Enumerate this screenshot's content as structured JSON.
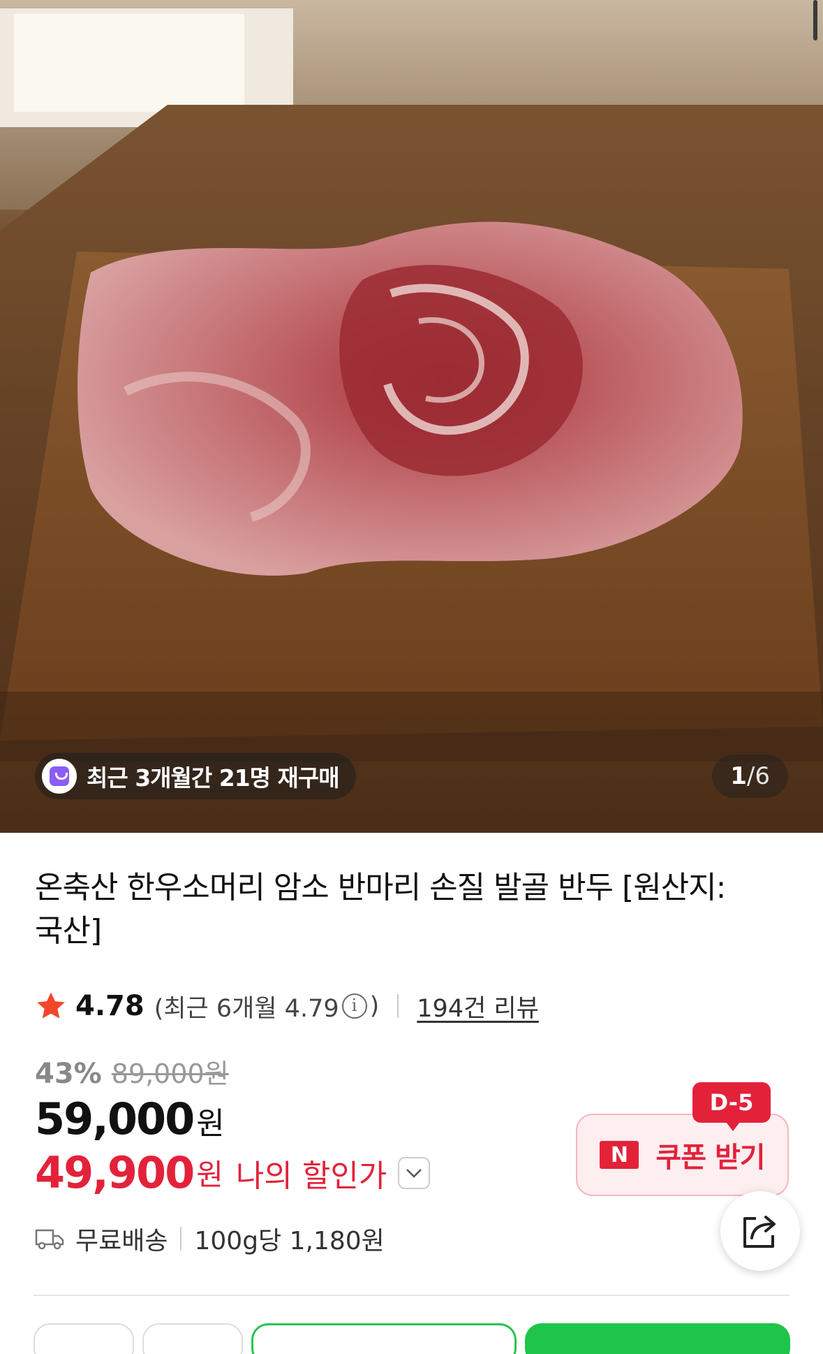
{
  "hero": {
    "repurchase_badge": "최근 3개월간 21명 재구매",
    "counter_current": "1",
    "counter_separator": "/",
    "counter_total": "6"
  },
  "product": {
    "title": "온축산 한우소머리 암소 반마리 손질 발골 반두 [원산지:국산]",
    "rating": "4.78",
    "rating_recent_prefix": "(최근 6개월 4.79",
    "rating_recent_suffix": ")",
    "review_link": "194건 리뷰",
    "discount_percent": "43%",
    "original_price": "89,000원",
    "price": "59,000",
    "price_unit": "원",
    "my_price": "49,900",
    "my_price_unit": "원",
    "my_price_label": "나의 할인가"
  },
  "coupon": {
    "dday": "D-5",
    "logo": "N",
    "label": "쿠폰 받기"
  },
  "shipping": {
    "free_shipping": "무료배송",
    "unit_price": "100g당 1,180원"
  },
  "icons": {
    "star": "star-icon",
    "info": "info-icon",
    "chevron": "chevron-down-icon",
    "truck": "truck-icon",
    "share": "share-icon"
  },
  "colors": {
    "accent_red": "#e3223a",
    "rating_star": "#f4462a",
    "badge_purple": "#8b5cf6",
    "buy_green": "#1ec54a"
  }
}
